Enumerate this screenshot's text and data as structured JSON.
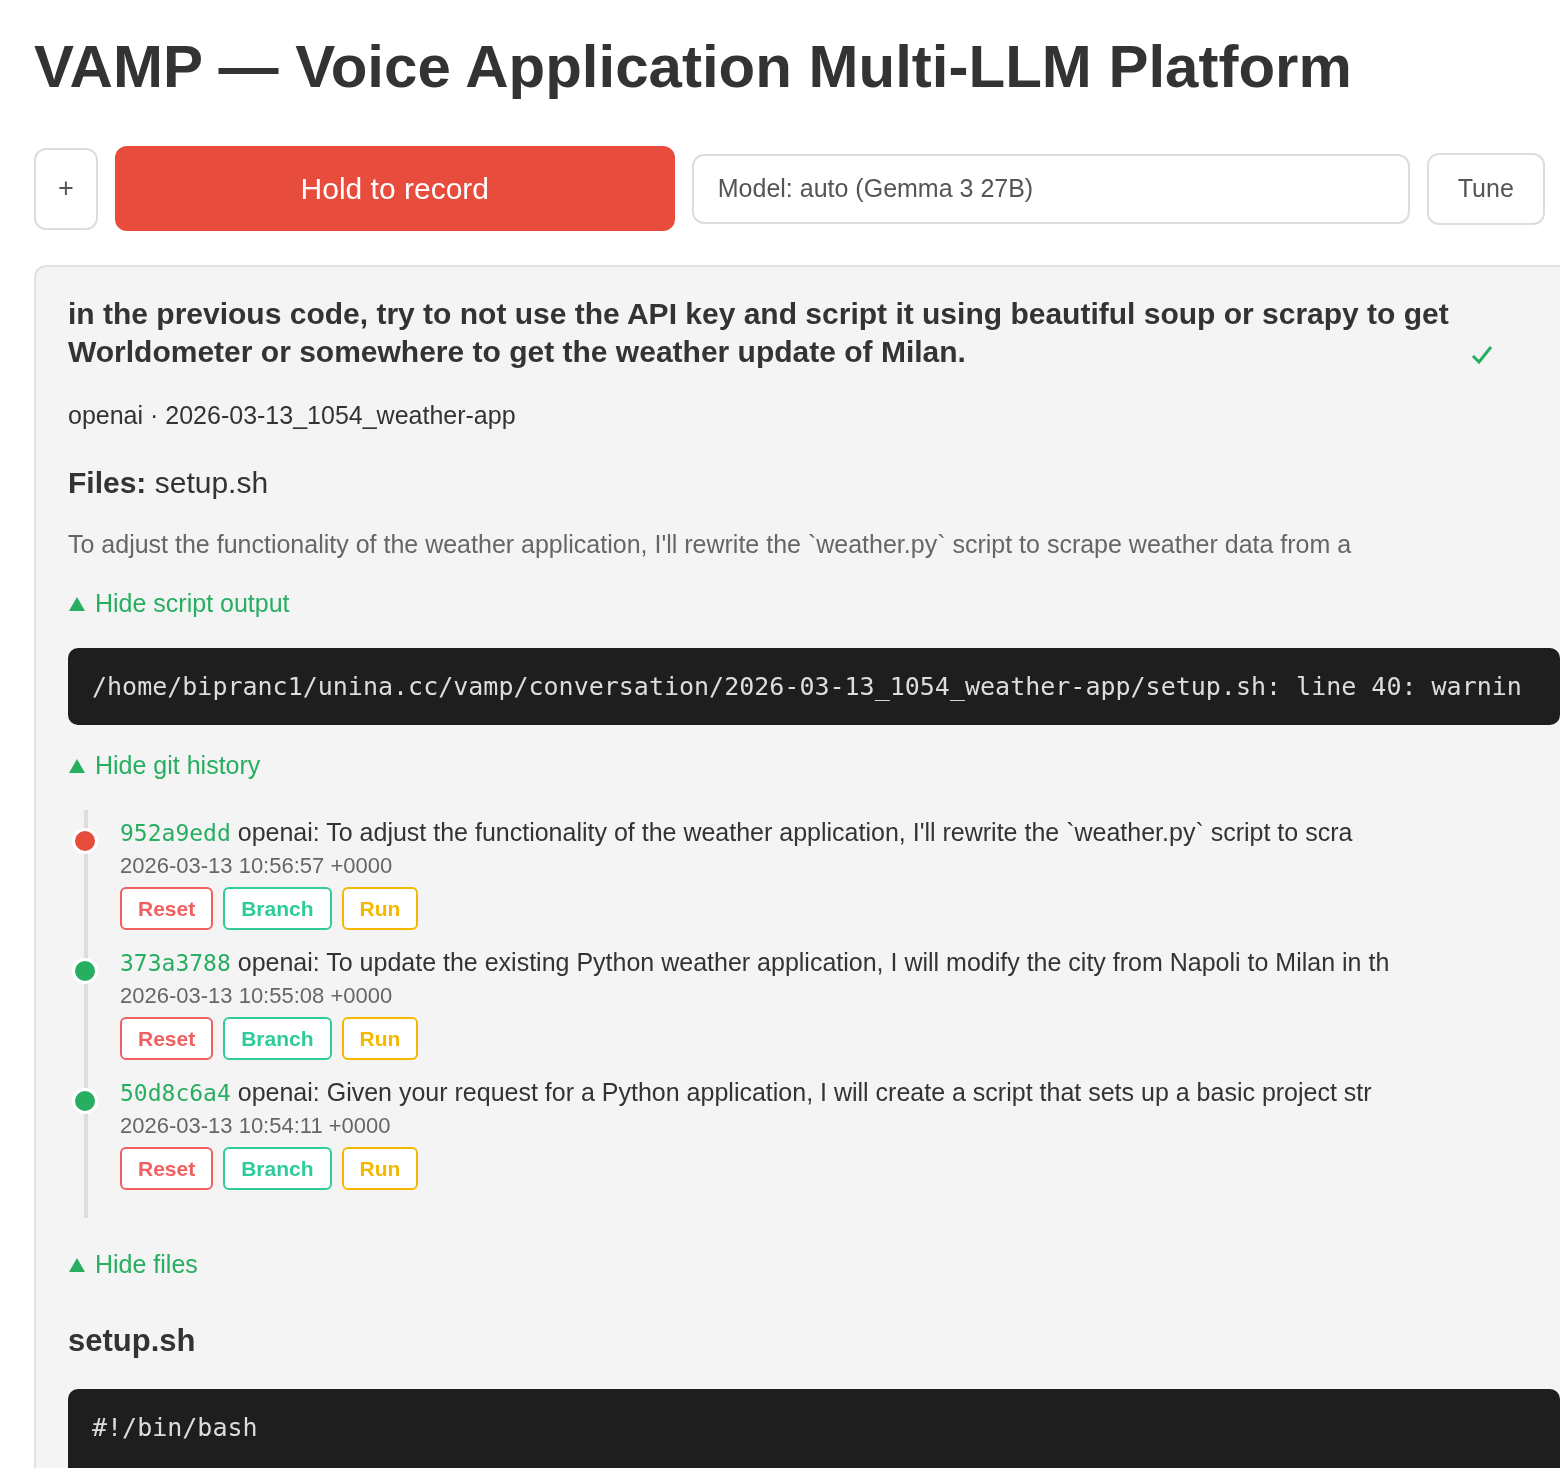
{
  "title": "VAMP — Voice Application Multi-LLM Platform",
  "toolbar": {
    "new_label": "+",
    "record_label": "Hold to record",
    "model": "Model: auto (Gemma 3 27B)",
    "tune_label": "Tune"
  },
  "conversation": {
    "prompt": "in the previous code, try to not use the API key and script it using beautiful soup or scrapy to get\nWorldometer or somewhere to get the weather update of Milan.",
    "done": true,
    "meta": "openai · 2026-03-13_1054_weather-app",
    "files_label": "Files:",
    "files_value": "setup.sh",
    "summary": "To adjust the functionality of the weather application, I'll rewrite the `weather.py` script to scrape weather data from a",
    "script_toggle": {
      "label": "Hide script output",
      "expanded": true
    },
    "script_output": "/home/bipranc1/unina.cc/vamp/conversation/2026-03-13_1054_weather-app/setup.sh: line 40: warnin",
    "git_toggle": {
      "label": "Hide git history",
      "expanded": true
    },
    "commits": [
      {
        "hash": "952a9edd",
        "message": "openai: To adjust the functionality of the weather application, I'll rewrite the `weather.py` script to scra",
        "date": "2026-03-13 10:56:57 +0000",
        "color": "#e74c3c",
        "actions": [
          "Reset",
          "Branch",
          "Run"
        ]
      },
      {
        "hash": "373a3788",
        "message": "openai: To update the existing Python weather application, I will modify the city from Napoli to Milan in th",
        "date": "2026-03-13 10:55:08 +0000",
        "color": "#27ae60",
        "actions": [
          "Reset",
          "Branch",
          "Run"
        ]
      },
      {
        "hash": "50d8c6a4",
        "message": "openai: Given your request for a Python application, I will create a script that sets up a basic project str",
        "date": "2026-03-13 10:54:11 +0000",
        "color": "#27ae60",
        "actions": [
          "Reset",
          "Branch",
          "Run"
        ]
      }
    ],
    "files_toggle": {
      "label": "Hide files",
      "expanded": true
    },
    "file_name": "setup.sh",
    "file_code": "#!/bin/bash"
  }
}
